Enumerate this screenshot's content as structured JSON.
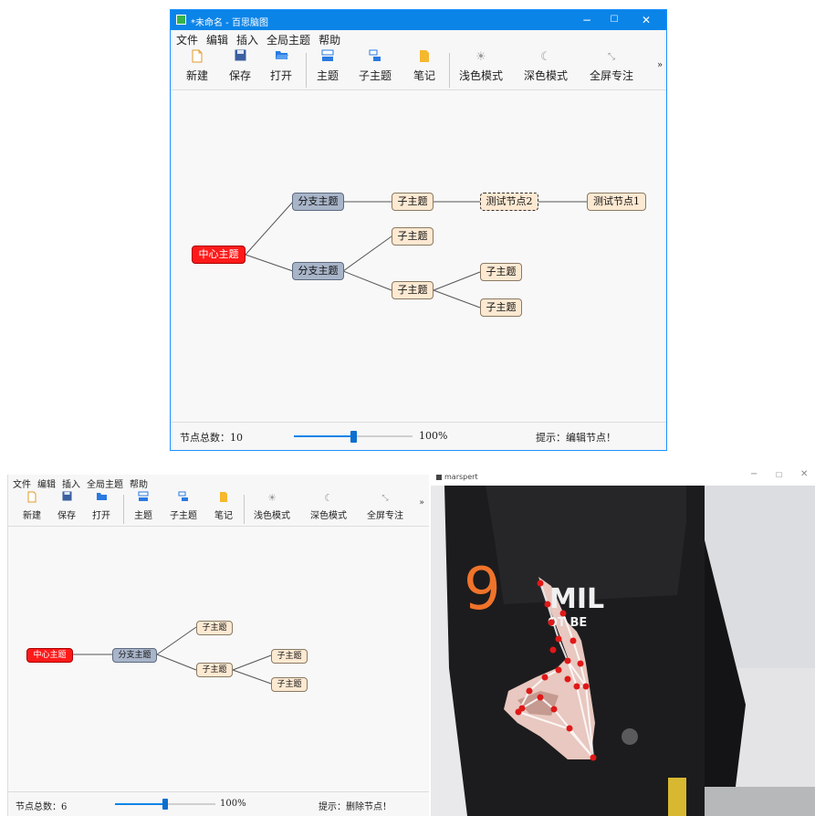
{
  "window1": {
    "title": "*未命名 - 百思脑图",
    "controls": {
      "minimize": "−",
      "maximize": "☐",
      "close": "✕"
    },
    "menu": [
      "文件",
      "编辑",
      "插入",
      "全局主题",
      "帮助"
    ],
    "toolbar": {
      "new": "新建",
      "save": "保存",
      "open": "打开",
      "topic": "主题",
      "subtopic": "子主题",
      "note": "笔记",
      "light_mode": "浅色模式",
      "dark_mode": "深色模式",
      "fullscreen": "全屏专注",
      "more": "»"
    },
    "nodes": {
      "root": "中心主题",
      "branch1": "分支主题",
      "branch2": "分支主题",
      "sub_b1": "子主题",
      "test2": "测试节点2",
      "test1": "测试节点1",
      "sub_b2_top": "子主题",
      "sub_b2_mid": "子主题",
      "leaf1": "子主题",
      "leaf2": "子主题"
    },
    "status": {
      "node_count": "节点总数：10",
      "zoom": "100%",
      "zoom_level": 0.5,
      "hint": "提示：编辑节点！"
    }
  },
  "window2": {
    "menu": [
      "文件",
      "编辑",
      "插入",
      "全局主题",
      "帮助"
    ],
    "toolbar": {
      "new": "新建",
      "save": "保存",
      "open": "打开",
      "topic": "主题",
      "subtopic": "子主题",
      "note": "笔记",
      "light_mode": "浅色模式",
      "dark_mode": "深色模式",
      "fullscreen": "全屏专注",
      "more": "»"
    },
    "nodes": {
      "root": "中心主题",
      "branch": "分支主题",
      "sub_top": "子主题",
      "sub_mid": "子主题",
      "leaf1": "子主题",
      "leaf2": "子主题"
    },
    "status": {
      "node_count": "节点总数：6",
      "zoom": "100%",
      "zoom_level": 0.5,
      "hint": "提示：删除节点！"
    }
  },
  "camera": {
    "title": "marspert",
    "controls": {
      "minimize": "−",
      "maximize": "☐",
      "close": "✕"
    },
    "gesture_digit": "9",
    "shirt_text_line1": "MIL",
    "shirt_text_line2": "OT BE"
  },
  "colors": {
    "titlebar": "#0b84e8",
    "root_node": "#ff1a1a",
    "branch_node": "#a8b4c8",
    "sub_node": "#fde9d2",
    "gesture_digit": "#f0732a",
    "landmark": "#e01818"
  }
}
